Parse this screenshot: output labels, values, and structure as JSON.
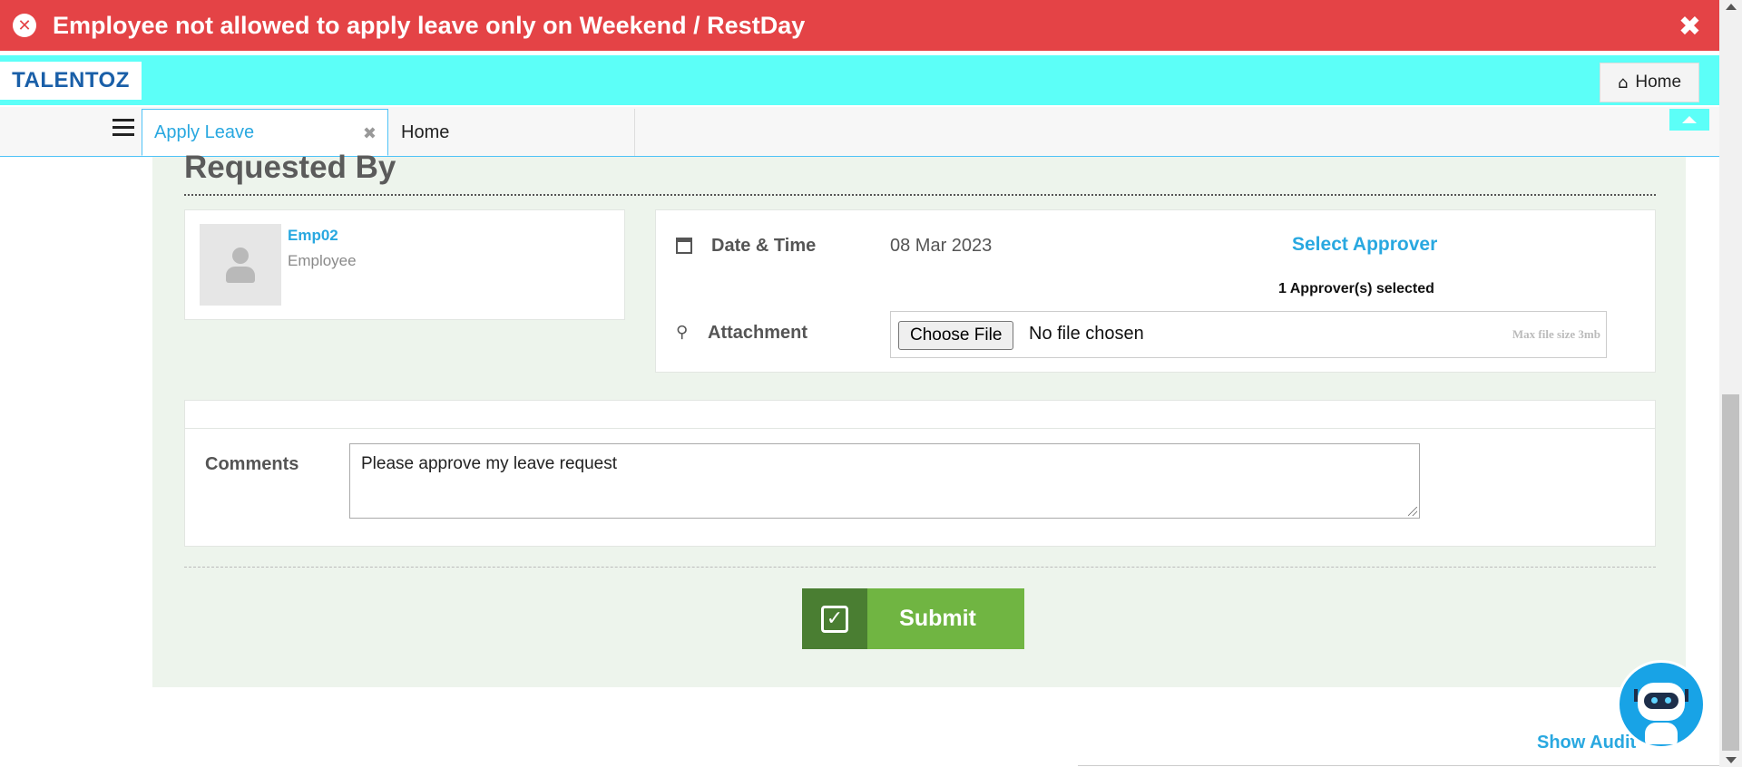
{
  "error": {
    "message": "Employee not allowed to apply leave only on Weekend / RestDay",
    "icon": "close-circle-icon",
    "close_icon": "times-icon"
  },
  "header": {
    "logo_text": "TALENTOZ",
    "home_label": "Home",
    "home_icon": "home-icon"
  },
  "tabs": [
    {
      "label": "Apply Leave",
      "active": true
    },
    {
      "label": "Home",
      "active": false
    }
  ],
  "section": {
    "title": "Requested By"
  },
  "employee": {
    "name": "Emp02",
    "role": "Employee"
  },
  "details": {
    "date_label": "Date & Time",
    "date_value": "08 Mar 2023",
    "select_approver": "Select Approver",
    "approver_count": "1 Approver(s) selected",
    "attachment_label": "Attachment",
    "choose_file": "Choose File",
    "no_file": "No file chosen",
    "max_size": "Max file size 3mb"
  },
  "comments": {
    "label": "Comments",
    "value": "Please approve my leave request"
  },
  "actions": {
    "submit": "Submit",
    "show_audit": "Show Audit"
  },
  "colors": {
    "error_bg": "#e44346",
    "header_bg": "#5cfff8",
    "link": "#29a8e0",
    "panel_bg": "#edf4ec",
    "submit": "#70b542",
    "submit_dark": "#4a7e32"
  }
}
